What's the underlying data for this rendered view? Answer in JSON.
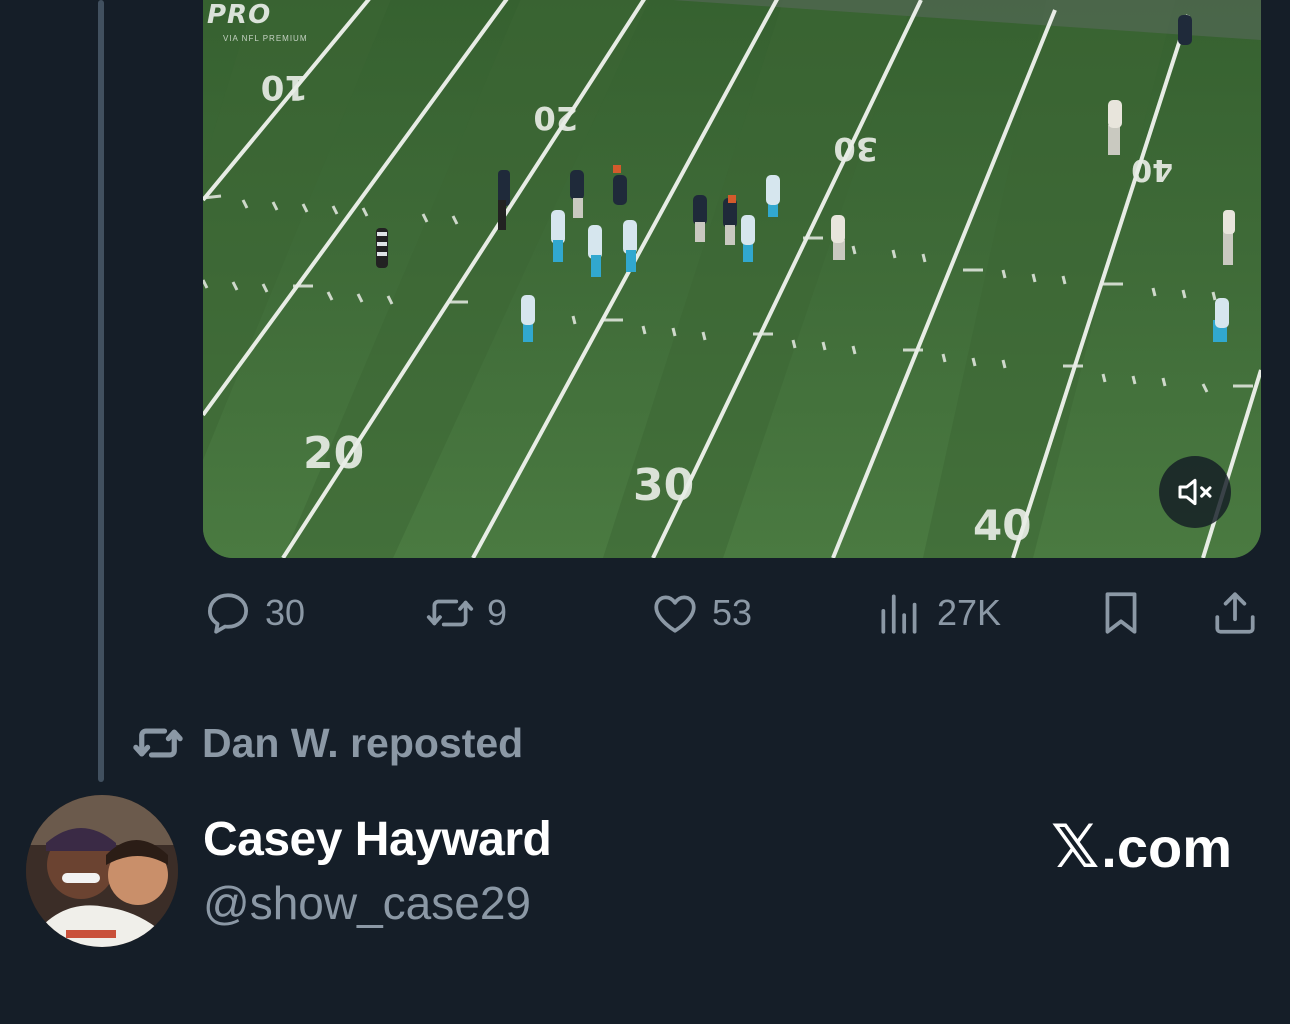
{
  "media": {
    "watermark": "PRO",
    "watermark_sub": "VIA NFL PREMIUM",
    "yard_numbers": [
      "10",
      "20",
      "30",
      "30",
      "40",
      "20",
      "30",
      "40"
    ],
    "mute_icon": "speaker-muted-icon"
  },
  "actions": {
    "replies": "30",
    "reposts": "9",
    "likes": "53",
    "views": "27K",
    "reply_icon": "reply-icon",
    "repost_icon": "repost-icon",
    "like_icon": "heart-icon",
    "views_icon": "views-chart-icon",
    "bookmark_icon": "bookmark-icon",
    "share_icon": "share-icon"
  },
  "repost_banner": {
    "text": "Dan W. reposted",
    "icon": "repost-icon"
  },
  "author": {
    "name": "Casey Hayward",
    "handle": "@show_case29"
  },
  "brand": {
    "x_glyph": "𝕏",
    "text": ".com"
  },
  "colors": {
    "background": "#151e28",
    "muted_text": "#8b98a5",
    "primary_text": "#ffffff",
    "thread_line": "#41505f",
    "field_green": "#3f6a37"
  }
}
